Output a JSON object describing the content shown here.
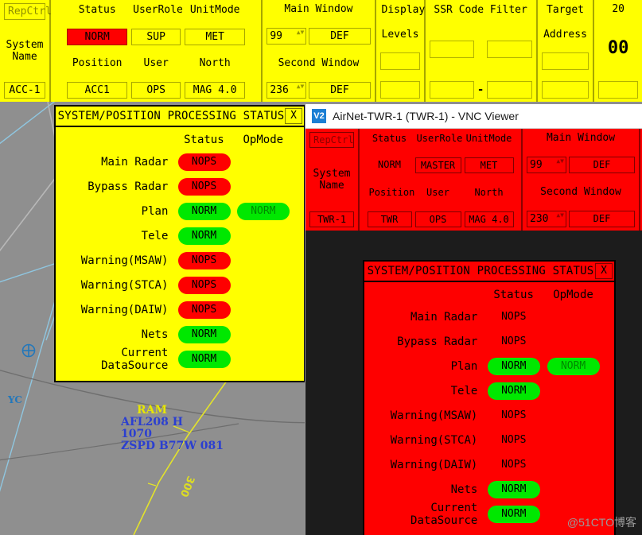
{
  "main_header": {
    "system": {
      "repctrl_label": "RepCtrl",
      "repctrl_disabled": true,
      "system_name_line1": "System",
      "system_name_line2": "Name",
      "system_name_value": "ACC-1"
    },
    "status_grid": {
      "col_headers": [
        "Status",
        "UserRole",
        "UnitMode"
      ],
      "row1_values": [
        "NORM",
        "SUP",
        "MET"
      ],
      "row2_headers": [
        "Position",
        "User",
        "North"
      ],
      "row2_values": [
        "ACC1",
        "OPS",
        "MAG 4.0"
      ]
    },
    "windows": {
      "main_window_label": "Main Window",
      "main_window_number": "99",
      "main_window_mode": "DEF",
      "second_window_label": "Second Window",
      "second_window_number": "236",
      "second_window_mode": "DEF"
    },
    "display_levels": {
      "label_line1": "Display",
      "label_line2": "Levels",
      "value_top": "",
      "value_bottom": ""
    },
    "ssr_code_filter": {
      "label": "SSR Code Filter",
      "top_left": "",
      "top_right": "",
      "bottom_left": "",
      "bottom_right": "",
      "separator": "-"
    },
    "target_address": {
      "label_line1": "Target",
      "label_line2": "Address",
      "value_top": "",
      "value_bottom": ""
    },
    "clock": {
      "date": "20",
      "time": "00"
    }
  },
  "vnc_window": {
    "icon_label": "V2",
    "title": "AirNet-TWR-1 (TWR-1) - VNC Viewer"
  },
  "vnc_header": {
    "system": {
      "repctrl_label": "RepCtrl",
      "repctrl_disabled": true,
      "system_name_line1": "System",
      "system_name_line2": "Name",
      "system_name_value": "TWR-1"
    },
    "status_grid": {
      "col_headers": [
        "Status",
        "UserRole",
        "UnitMode"
      ],
      "row1_values": [
        "NORM",
        "MASTER",
        "MET"
      ],
      "row2_headers": [
        "Position",
        "User",
        "North"
      ],
      "row2_values": [
        "TWR",
        "OPS",
        "MAG 4.0"
      ]
    },
    "windows": {
      "main_window_label": "Main Window",
      "main_window_number": "99",
      "main_window_mode": "DEF",
      "second_window_label": "Second Window",
      "second_window_number": "230",
      "second_window_mode": "DEF"
    }
  },
  "status_dialog_yellow": {
    "title": "SYSTEM/POSITION PROCESSING STATUS",
    "close_label": "X",
    "col_status": "Status",
    "col_opmode": "OpMode",
    "rows": [
      {
        "name": "Main Radar",
        "status": "NOPS",
        "status_kind": "red",
        "opmode": "",
        "opmode_kind": "none"
      },
      {
        "name": "Bypass Radar",
        "status": "NOPS",
        "status_kind": "red",
        "opmode": "",
        "opmode_kind": "none"
      },
      {
        "name": "Plan",
        "status": "NORM",
        "status_kind": "green",
        "opmode": "NORM",
        "opmode_kind": "green-dim"
      },
      {
        "name": "Tele",
        "status": "NORM",
        "status_kind": "green",
        "opmode": "",
        "opmode_kind": "none"
      },
      {
        "name": "Warning(MSAW)",
        "status": "NOPS",
        "status_kind": "red",
        "opmode": "",
        "opmode_kind": "none"
      },
      {
        "name": "Warning(STCA)",
        "status": "NOPS",
        "status_kind": "red",
        "opmode": "",
        "opmode_kind": "none"
      },
      {
        "name": "Warning(DAIW)",
        "status": "NOPS",
        "status_kind": "red",
        "opmode": "",
        "opmode_kind": "none"
      },
      {
        "name": "Nets",
        "status": "NORM",
        "status_kind": "green",
        "opmode": "",
        "opmode_kind": "none"
      },
      {
        "name": "Current DataSource",
        "status": "NORM",
        "status_kind": "green",
        "opmode": "",
        "opmode_kind": "none"
      }
    ]
  },
  "status_dialog_red": {
    "title": "SYSTEM/POSITION PROCESSING STATUS",
    "close_label": "X",
    "col_status": "Status",
    "col_opmode": "OpMode",
    "rows": [
      {
        "name": "Main Radar",
        "status": "NOPS",
        "status_kind": "flat",
        "opmode": "",
        "opmode_kind": "none"
      },
      {
        "name": "Bypass Radar",
        "status": "NOPS",
        "status_kind": "flat",
        "opmode": "",
        "opmode_kind": "none"
      },
      {
        "name": "Plan",
        "status": "NORM",
        "status_kind": "green",
        "opmode": "NORM",
        "opmode_kind": "green-dim"
      },
      {
        "name": "Tele",
        "status": "NORM",
        "status_kind": "green",
        "opmode": "",
        "opmode_kind": "none"
      },
      {
        "name": "Warning(MSAW)",
        "status": "NOPS",
        "status_kind": "flat",
        "opmode": "",
        "opmode_kind": "none"
      },
      {
        "name": "Warning(STCA)",
        "status": "NOPS",
        "status_kind": "flat",
        "opmode": "",
        "opmode_kind": "none"
      },
      {
        "name": "Warning(DAIW)",
        "status": "NOPS",
        "status_kind": "flat",
        "opmode": "",
        "opmode_kind": "none"
      },
      {
        "name": "Nets",
        "status": "NORM",
        "status_kind": "green",
        "opmode": "",
        "opmode_kind": "none"
      },
      {
        "name": "Current DataSource",
        "status": "NORM",
        "status_kind": "green",
        "opmode": "",
        "opmode_kind": "none"
      }
    ]
  },
  "map": {
    "waypoint_label": "YC",
    "aircraft": {
      "ram_tag": "RAM",
      "line1": "AFL208 H",
      "line2": "1070",
      "line3": "ZSPD B77W 081"
    },
    "airway_label": "300"
  },
  "watermark": "@51CTO博客",
  "colors": {
    "yellow": "#ffff00",
    "red": "#fe0000",
    "green": "#00e800",
    "map_bg": "#8f8f8f",
    "aircraft_blue": "#2b3fd0",
    "sector_blue": "#8fc6e0"
  }
}
